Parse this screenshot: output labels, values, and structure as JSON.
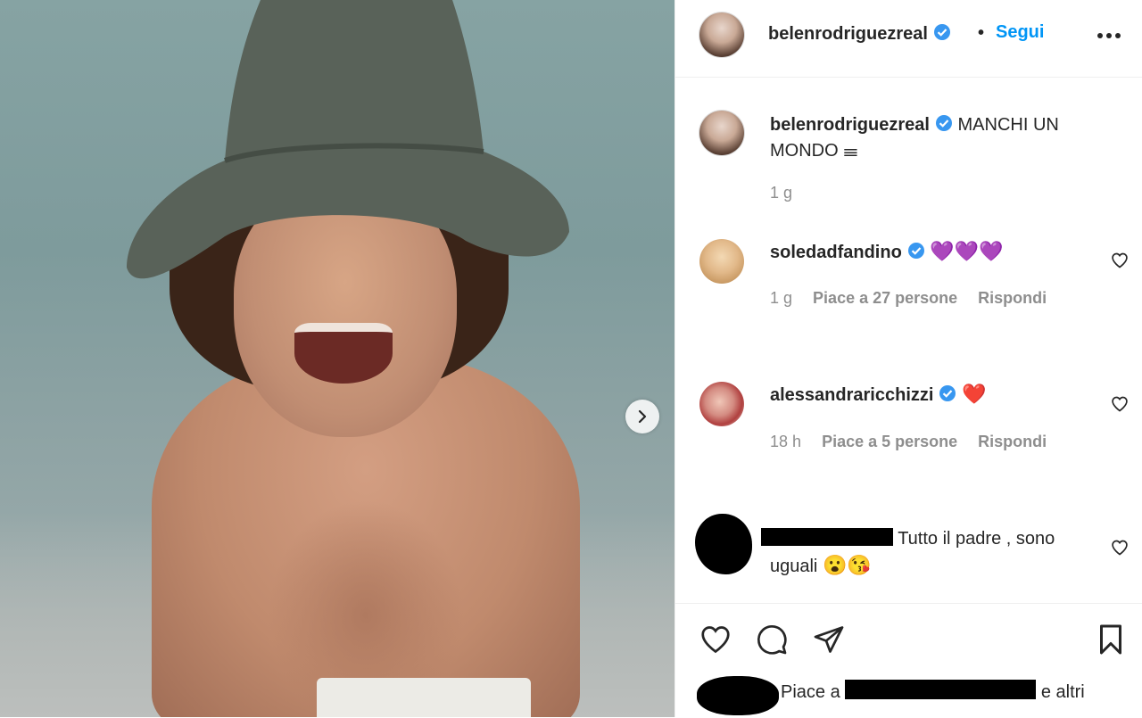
{
  "post_author": {
    "username": "belenrodriguezreal",
    "follow_label": "Segui",
    "separator": "•"
  },
  "caption": {
    "username": "belenrodriguezreal",
    "text": "MANCHI UN MONDO",
    "emoji": "𝍢",
    "time": "1 g"
  },
  "comments": [
    {
      "username": "soledadfandino",
      "text": "💜💜💜",
      "time": "1 g",
      "likes": "Piace a 27 persone",
      "reply": "Rispondi"
    },
    {
      "username": "alessandraricchizzi",
      "text": "❤️",
      "time": "18 h",
      "likes": "Piace a 5 persone",
      "reply": "Rispondi"
    },
    {
      "username": "",
      "text": "Tutto il padre , sono uguali",
      "emoji": "😮😘"
    }
  ],
  "likes_line": {
    "prefix": "Piace a",
    "suffix": "e altri"
  },
  "icons": {
    "verified": "verified-badge-icon",
    "more": "more-horizontal-icon",
    "next": "chevron-right-icon",
    "like": "heart-icon",
    "comment": "comment-bubble-icon",
    "share": "paper-plane-icon",
    "save": "bookmark-icon"
  },
  "colors": {
    "accent": "#0095f6",
    "text": "#262626",
    "secondary": "#8e8e8e",
    "verified": "#3897f0"
  }
}
